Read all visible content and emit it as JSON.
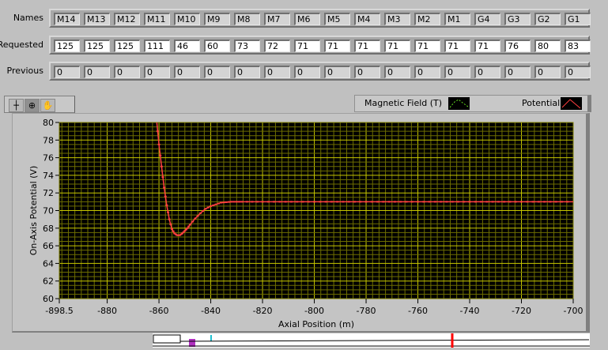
{
  "rows": {
    "names_label": "Names",
    "requested_label": "Requested",
    "previous_label": "Previous",
    "names": [
      "M14",
      "M13",
      "M12",
      "M11",
      "M10",
      "M9",
      "M8",
      "M7",
      "M6",
      "M5",
      "M4",
      "M3",
      "M2",
      "M1",
      "G4",
      "G3",
      "G2",
      "G1"
    ],
    "requested": [
      "125",
      "125",
      "125",
      "111",
      "46",
      "60",
      "73",
      "72",
      "71",
      "71",
      "71",
      "71",
      "71",
      "71",
      "71",
      "76",
      "80",
      "83"
    ],
    "previous": [
      "0",
      "0",
      "0",
      "0",
      "0",
      "0",
      "0",
      "0",
      "0",
      "0",
      "0",
      "0",
      "0",
      "0",
      "0",
      "0",
      "0",
      "0"
    ]
  },
  "legend": {
    "items": [
      {
        "label": "Magnetic Field (T)",
        "color": "#66dd22"
      },
      {
        "label": "Potential (V)",
        "color": "#ff4040"
      }
    ]
  },
  "palette": {
    "tools": [
      "cursor-move",
      "zoom",
      "pan"
    ]
  },
  "chart_data": {
    "type": "line",
    "xlabel": "Axial Position (m)",
    "ylabel": "On-Axis Potential (V)",
    "xlim": [
      -898.5,
      -700
    ],
    "ylim": [
      60,
      80
    ],
    "xticks": [
      "-898.5",
      "-880",
      "-860",
      "-840",
      "-820",
      "-800",
      "-780",
      "-760",
      "-740",
      "-720",
      "-700"
    ],
    "yticks": [
      "60",
      "62",
      "64",
      "66",
      "68",
      "70",
      "72",
      "74",
      "76",
      "78",
      "80"
    ],
    "grid": true,
    "series": [
      {
        "name": "Potential (V)",
        "color": "#ff4040",
        "x": [
          -861,
          -860,
          -859,
          -858,
          -857,
          -856,
          -855,
          -854,
          -853,
          -852,
          -851,
          -850,
          -849,
          -848,
          -846,
          -844,
          -842,
          -840,
          -838,
          -836,
          -834,
          -832,
          -830,
          -828,
          -820,
          -800,
          -780,
          -760,
          -740,
          -720,
          -700
        ],
        "y": [
          80.5,
          77.5,
          75.0,
          72.6,
          70.6,
          69.0,
          67.9,
          67.4,
          67.2,
          67.2,
          67.4,
          67.7,
          68.0,
          68.4,
          69.1,
          69.7,
          70.2,
          70.5,
          70.7,
          70.9,
          70.95,
          71,
          71,
          71,
          71,
          71,
          71,
          71,
          71,
          71,
          71
        ]
      }
    ]
  }
}
